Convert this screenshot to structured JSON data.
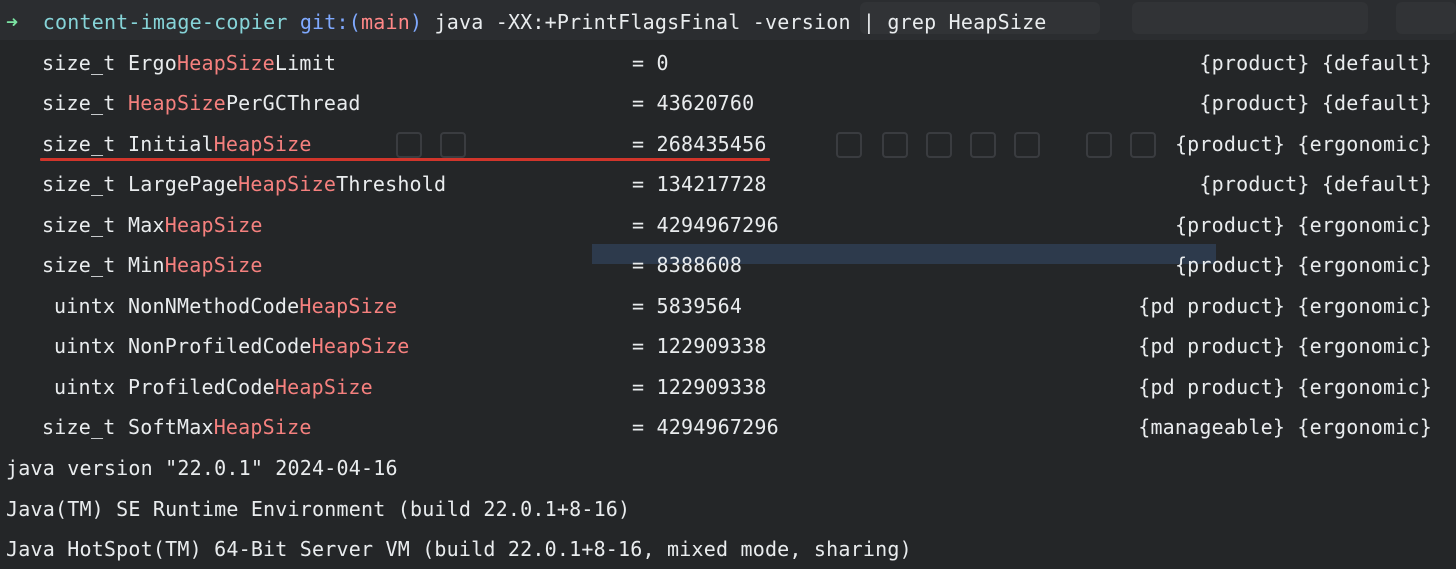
{
  "prompt": {
    "arrow": "➜",
    "directory": "content-image-copier",
    "git_label": "git:(",
    "branch": "main",
    "git_close": ")",
    "command": "java -XX:+PrintFlagsFinal -version | grep HeapSize"
  },
  "highlight_term": "HeapSize",
  "flags": [
    {
      "type": "size_t",
      "name_prefix": "Ergo",
      "name_match": "HeapSize",
      "name_suffix": "Limit",
      "value": "= 0",
      "origin": "{product} {default}"
    },
    {
      "type": "size_t",
      "name_prefix": "",
      "name_match": "HeapSize",
      "name_suffix": "PerGCThread",
      "value": "= 43620760",
      "origin": "{product} {default}"
    },
    {
      "type": "size_t",
      "name_prefix": "Initial",
      "name_match": "HeapSize",
      "name_suffix": "",
      "value": "= 268435456",
      "origin": "{product} {ergonomic}"
    },
    {
      "type": "size_t",
      "name_prefix": "LargePage",
      "name_match": "HeapSize",
      "name_suffix": "Threshold",
      "value": "= 134217728",
      "origin": "{product} {default}"
    },
    {
      "type": "size_t",
      "name_prefix": "Max",
      "name_match": "HeapSize",
      "name_suffix": "",
      "value": "= 4294967296",
      "origin": "{product} {ergonomic}"
    },
    {
      "type": "size_t",
      "name_prefix": "Min",
      "name_match": "HeapSize",
      "name_suffix": "",
      "value": "= 8388608",
      "origin": "{product} {ergonomic}"
    },
    {
      "type": "uintx",
      "name_prefix": "NonNMethodCode",
      "name_match": "HeapSize",
      "name_suffix": "",
      "value": "= 5839564",
      "origin": "{pd product} {ergonomic}"
    },
    {
      "type": "uintx",
      "name_prefix": "NonProfiledCode",
      "name_match": "HeapSize",
      "name_suffix": "",
      "value": "= 122909338",
      "origin": "{pd product} {ergonomic}"
    },
    {
      "type": "uintx",
      "name_prefix": "ProfiledCode",
      "name_match": "HeapSize",
      "name_suffix": "",
      "value": "= 122909338",
      "origin": "{pd product} {ergonomic}"
    },
    {
      "type": "size_t",
      "name_prefix": "SoftMax",
      "name_match": "HeapSize",
      "name_suffix": "",
      "value": "= 4294967296",
      "origin": "{manageable} {ergonomic}"
    }
  ],
  "version_lines": [
    "java version \"22.0.1\" 2024-04-16",
    "Java(TM) SE Runtime Environment (build 22.0.1+8-16)",
    "Java HotSpot(TM) 64-Bit Server VM (build 22.0.1+8-16, mixed mode, sharing)"
  ],
  "colors": {
    "background": "#242628",
    "text": "#e9ecee",
    "highlight": "#f5807e",
    "underline": "#d1352b"
  }
}
